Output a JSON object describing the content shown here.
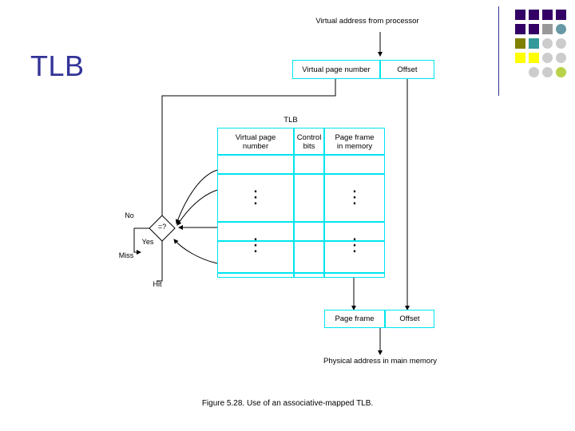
{
  "slide": {
    "title": "TLB",
    "caption": "Figure 5.28. Use of an associative-mapped TLB.",
    "top_label": "Virtual address from processor",
    "bottom_label": "Physical address in main memory",
    "tlb_label": "TLB",
    "accent_color": "#00e5ee",
    "title_color": "#333399"
  },
  "address_row": {
    "virtual_page_number": "Virtual page number",
    "offset": "Offset"
  },
  "tlb_headers": {
    "virtual_page_number": "Virtual page\nnumber",
    "control_bits": "Control\nbits",
    "page_frame": "Page frame\nin memory"
  },
  "physical_row": {
    "page_frame": "Page frame",
    "offset": "Offset"
  },
  "decisions": {
    "no": "No",
    "yes": "Yes",
    "miss": "Miss",
    "hit": "Hit",
    "compare": "=?"
  },
  "ellipses": {
    "vertical_dots": "⋮"
  },
  "deco": {
    "colors": {
      "dark_purple": "#330066",
      "teal": "#339999",
      "yellow": "#ffff00",
      "gray": "#999999",
      "light_gray": "#cccccc",
      "olive": "#808000",
      "steel": "#6699a5"
    }
  }
}
